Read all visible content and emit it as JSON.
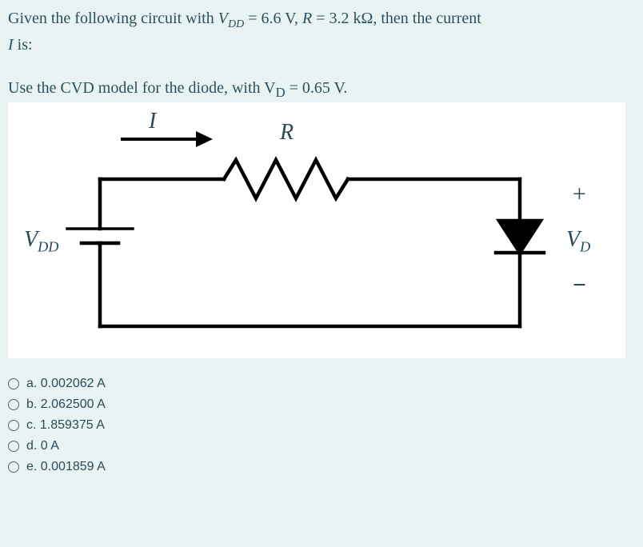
{
  "question": {
    "line1_pre": "Given the following circuit with ",
    "vdd_sym": "V",
    "vdd_sub": "DD",
    "vdd_val": " = 6.6 V, ",
    "r_sym": "R",
    "r_val": " = 3.2 kΩ, then the current",
    "line2_pre": "",
    "i_sym": "I",
    "line2_post": " is:"
  },
  "instruction": {
    "pre": "Use the CVD model for the diode, with ",
    "vd_sym": "V",
    "vd_sub": "D",
    "vd_val": " = 0.65 V."
  },
  "circuit": {
    "label_I": "I",
    "label_R": "R",
    "label_VDD": "V",
    "label_VDD_sub": "DD",
    "label_VD": "V",
    "label_VD_sub": "D",
    "plus": "+",
    "minus": "−"
  },
  "options": [
    {
      "letter": "a.",
      "text": "0.002062 A"
    },
    {
      "letter": "b.",
      "text": "2.062500 A"
    },
    {
      "letter": "c.",
      "text": "1.859375 A"
    },
    {
      "letter": "d.",
      "text": "0 A"
    },
    {
      "letter": "e.",
      "text": "0.001859 A"
    }
  ]
}
